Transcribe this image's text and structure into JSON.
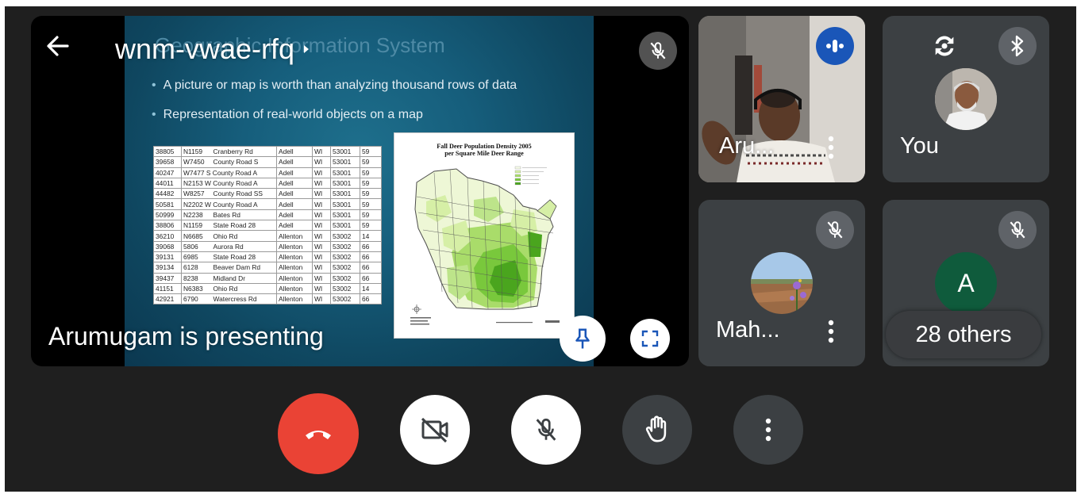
{
  "meeting": {
    "code": "wnm-vwae-rfq",
    "presenting_text": "Arumugam is presenting"
  },
  "slide": {
    "title": "Geographic Information System",
    "bullets": [
      "A picture or map is worth than analyzing thousand rows of data",
      "Representation of real-world objects on a map"
    ],
    "table_rows": [
      [
        "38805",
        "N1159",
        "Cranberry Rd",
        "Adell",
        "WI",
        "53001",
        "59"
      ],
      [
        "39658",
        "W7450",
        "County Road S",
        "Adell",
        "WI",
        "53001",
        "59"
      ],
      [
        "40247",
        "W7477 S County Road A",
        "",
        "Adell",
        "WI",
        "53001",
        "59"
      ],
      [
        "44011",
        "N2153 W County Road A",
        "",
        "Adell",
        "WI",
        "53001",
        "59"
      ],
      [
        "44482",
        "W8257",
        "County Road SS",
        "Adell",
        "WI",
        "53001",
        "59"
      ],
      [
        "50581",
        "N2202 W County Road A",
        "",
        "Adell",
        "WI",
        "53001",
        "59"
      ],
      [
        "50999",
        "N2238",
        "Bates Rd",
        "Adell",
        "WI",
        "53001",
        "59"
      ],
      [
        "38806",
        "N1159",
        "State Road 28",
        "Adell",
        "WI",
        "53001",
        "59"
      ],
      [
        "36210",
        "N6685",
        "Ohio Rd",
        "Allenton",
        "WI",
        "53002",
        "14"
      ],
      [
        "39068",
        "5806",
        "Aurora Rd",
        "Allenton",
        "WI",
        "53002",
        "66"
      ],
      [
        "39131",
        "6985",
        "State Road 28",
        "Allenton",
        "WI",
        "53002",
        "66"
      ],
      [
        "39134",
        "6128",
        "Beaver Dam Rd",
        "Allenton",
        "WI",
        "53002",
        "66"
      ],
      [
        "39437",
        "8238",
        "Midland Dr",
        "Allenton",
        "WI",
        "53002",
        "66"
      ],
      [
        "41151",
        "N6383",
        "Ohio Rd",
        "Allenton",
        "WI",
        "53002",
        "14"
      ],
      [
        "42921",
        "6790",
        "Watercress Rd",
        "Allenton",
        "WI",
        "53002",
        "66"
      ]
    ],
    "map_title_line1": "Fall Deer Population Density 2005",
    "map_title_line2": "per Square Mile Deer Range"
  },
  "participants": [
    {
      "name": "Aru...",
      "status": "speaking"
    },
    {
      "name": "You",
      "status": "self"
    },
    {
      "name": "Mah...",
      "status": "muted"
    },
    {
      "name": "A",
      "initial": "A",
      "status": "muted",
      "avatar_color": "#0f5b3c"
    }
  ],
  "others_label": "28 others",
  "icons": {
    "back": "arrow-left-icon",
    "chevron": "chevron-right-icon",
    "mic_off": "mic-off-icon",
    "speaking": "audio-wave-icon",
    "camera_flip": "camera-flip-icon",
    "bluetooth": "bluetooth-icon",
    "pin": "pin-icon",
    "fullscreen": "fullscreen-icon",
    "end_call": "end-call-icon",
    "camera_off": "camera-off-icon",
    "raise_hand": "raise-hand-icon",
    "more": "more-vert-icon"
  },
  "colors": {
    "background": "#1f1f1f",
    "tile": "#3c4043",
    "end_call": "#ea4335",
    "speaking_badge": "#1a56b8"
  }
}
